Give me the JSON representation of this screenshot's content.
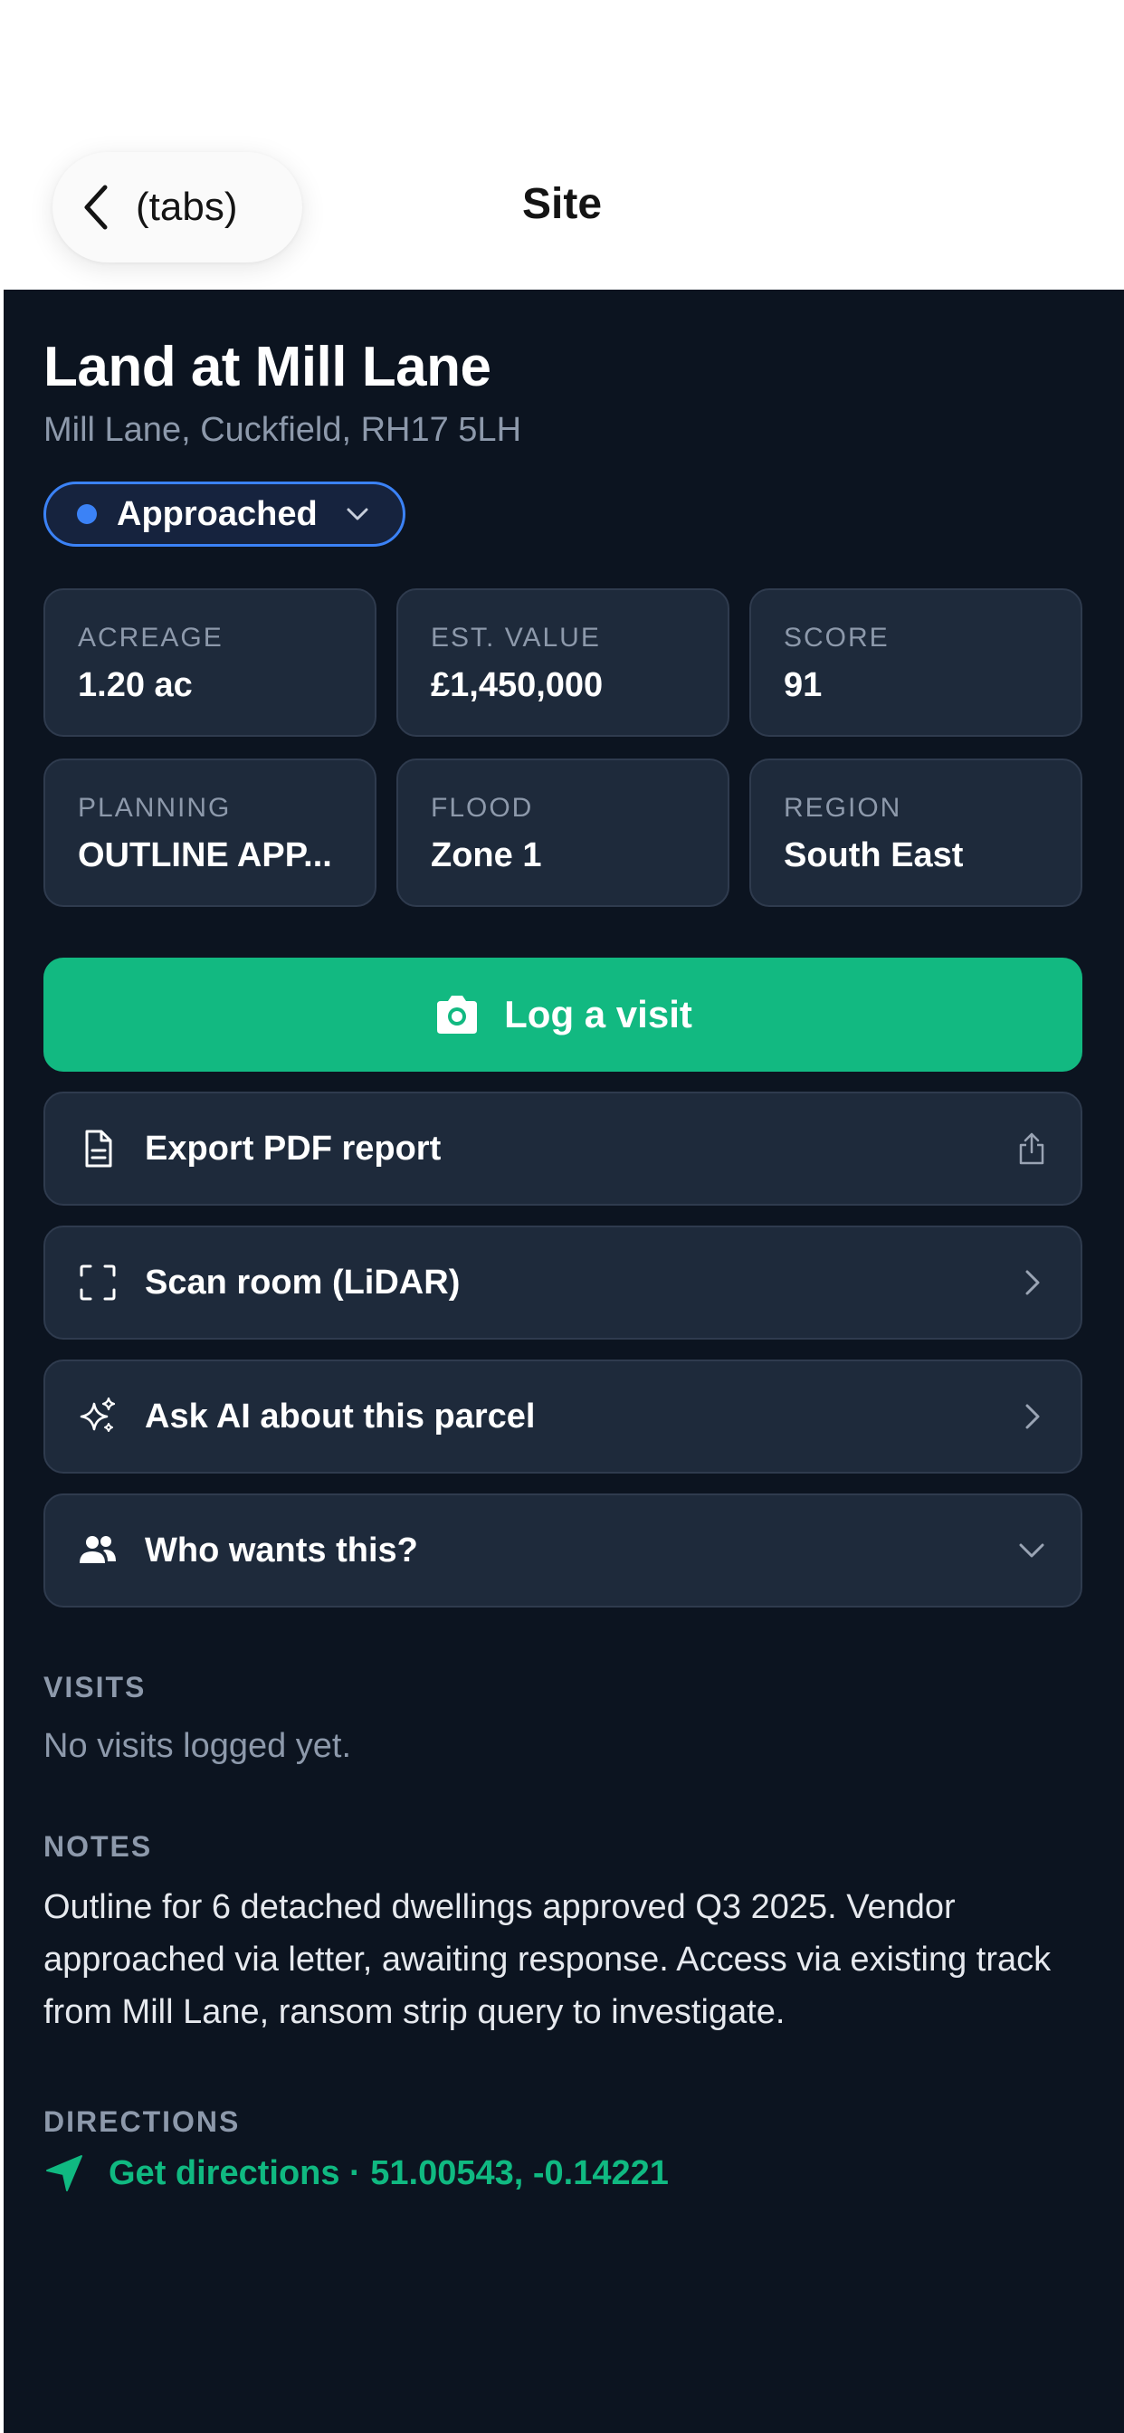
{
  "nav": {
    "back_label": "(tabs)",
    "title": "Site"
  },
  "site": {
    "title": "Land at Mill Lane",
    "address": "Mill Lane, Cuckfield, RH17 5LH"
  },
  "status": {
    "label": "Approached",
    "color": "#3b82f6"
  },
  "stats": [
    {
      "label": "ACREAGE",
      "value": "1.20 ac"
    },
    {
      "label": "EST. VALUE",
      "value": "£1,450,000"
    },
    {
      "label": "SCORE",
      "value": "91"
    },
    {
      "label": "PLANNING",
      "value": "OUTLINE APP..."
    },
    {
      "label": "FLOOD",
      "value": "Zone 1"
    },
    {
      "label": "REGION",
      "value": "South East"
    }
  ],
  "cta": {
    "label": "Log a visit",
    "icon": "camera-icon",
    "color": "#12b981"
  },
  "actions": [
    {
      "label": "Export PDF report",
      "icon": "document-icon",
      "trail": "share-icon"
    },
    {
      "label": "Scan room (LiDAR)",
      "icon": "scan-frame-icon",
      "trail": "chevron-right-icon"
    },
    {
      "label": "Ask AI about this parcel",
      "icon": "sparkles-icon",
      "trail": "chevron-right-icon"
    },
    {
      "label": "Who wants this?",
      "icon": "users-icon",
      "trail": "chevron-down-icon"
    }
  ],
  "visits": {
    "heading": "VISITS",
    "empty": "No visits logged yet."
  },
  "notes": {
    "heading": "NOTES",
    "text": "Outline for 6 detached dwellings approved Q3 2025. Vendor approached via letter, awaiting response. Access via existing track from Mill Lane, ransom strip query to investigate."
  },
  "directions": {
    "heading": "DIRECTIONS",
    "link": "Get directions · 51.00543, -0.14221",
    "icon": "navigation-arrow-icon"
  }
}
